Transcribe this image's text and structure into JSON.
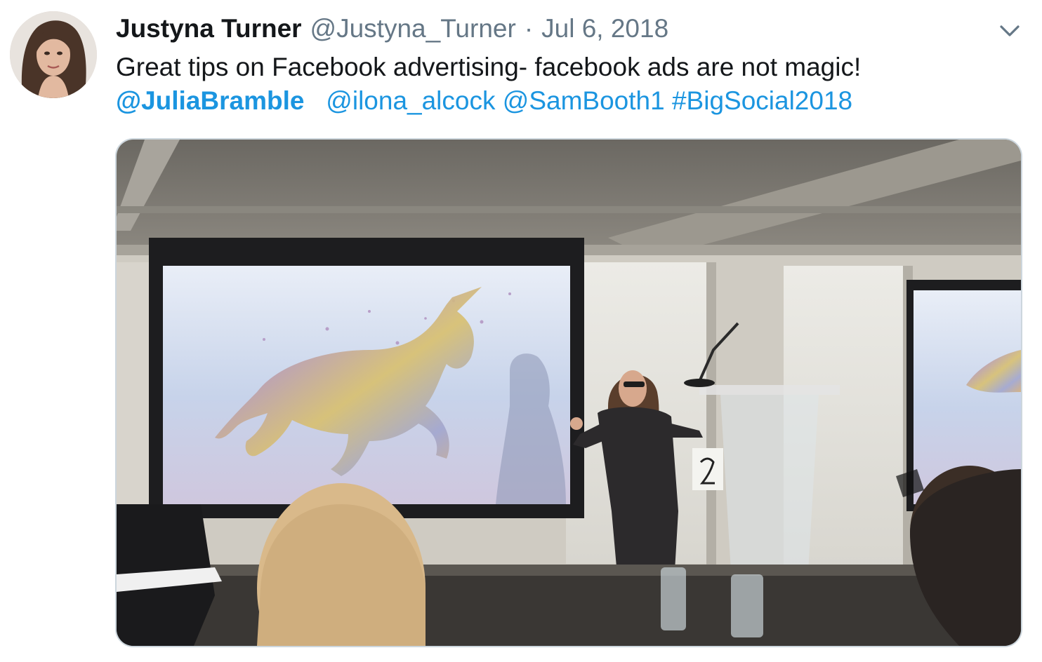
{
  "tweet": {
    "author": {
      "display_name": "Justyna Turner",
      "handle": "@Justyna_Turner"
    },
    "separator": "·",
    "date": "Jul 6, 2018",
    "text": "Great tips on Facebook advertising- facebook ads are not magic!",
    "mentions": [
      "@JuliaBramble",
      "@ilona_alcock",
      "@SamBooth1"
    ],
    "hashtag": "#BigSocial2018",
    "menu_icon": "chevron-down-icon",
    "media": {
      "type": "photo",
      "podium_number": "2"
    }
  },
  "colors": {
    "name": "#14171a",
    "secondary": "#657786",
    "link": "#1b95e0",
    "media_border": "#ccd6dd"
  }
}
